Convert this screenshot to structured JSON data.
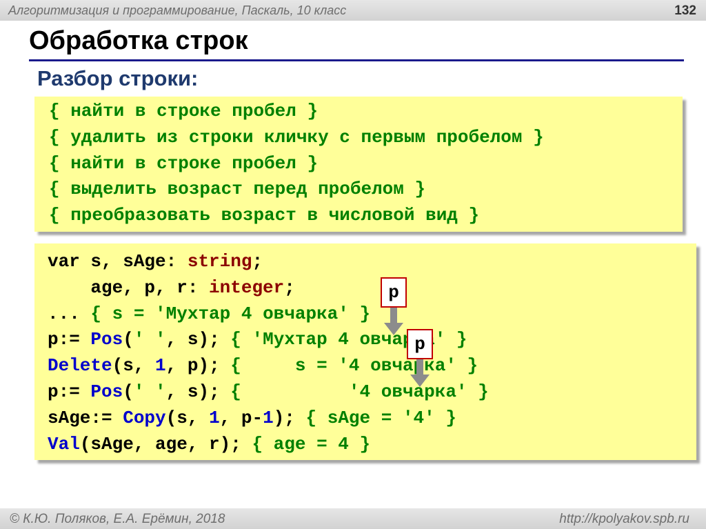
{
  "header": {
    "course": "Алгоритмизация и программирование, Паскаль, 10 класс",
    "page_number": "132"
  },
  "slide": {
    "title": "Обработка строк",
    "subtitle": "Разбор строки:"
  },
  "plan_comments": [
    "{ найти в строке пробел }",
    "{ удалить из строки кличку с первым пробелом }",
    "{ найти в строке пробел }",
    "{ выделить возраст перед пробелом }",
    "{ преобразовать возраст в числовой вид }"
  ],
  "code": {
    "l1_kw_var": "var",
    "l1_vars": " s, sAge: ",
    "l1_type": "string",
    "l1_end": ";",
    "l2_vars": "    age, p, r: ",
    "l2_type": "integer",
    "l2_end": ";",
    "l3_dots": "... ",
    "l3_comment": "{ s = 'Мухтар 4 овчарка' }",
    "l4_assign": "p:= ",
    "l4_fn": "Pos",
    "l4_open": "(",
    "l4_str": "' '",
    "l4_rest": ", s); ",
    "l4_comment": "{ 'Мухтар 4 овчарка' }",
    "l5_fn": "Delete",
    "l5_a": "(s, ",
    "l5_num": "1",
    "l5_b": ", p); ",
    "l5_comment": "{     s = '4 овчарка' }",
    "l6_assign": "p:= ",
    "l6_fn": "Pos",
    "l6_open": "(",
    "l6_str": "' '",
    "l6_rest": ", s); ",
    "l6_comment": "{          '4 овчарка' }",
    "l7_assign": "sAge:= ",
    "l7_fn": "Copy",
    "l7_a": "(s, ",
    "l7_num1": "1",
    "l7_b": ", p-",
    "l7_num2": "1",
    "l7_c": "); ",
    "l7_comment": "{ sAge = '4' }",
    "l8_fn": "Val",
    "l8_rest": "(sAge, age, r); ",
    "l8_comment": "{ age = 4 }"
  },
  "markers": {
    "first": "p",
    "second": "p"
  },
  "footer": {
    "copyright": "© К.Ю. Поляков, Е.А. Ерёмин, 2018",
    "url": "http://kpolyakov.spb.ru"
  }
}
